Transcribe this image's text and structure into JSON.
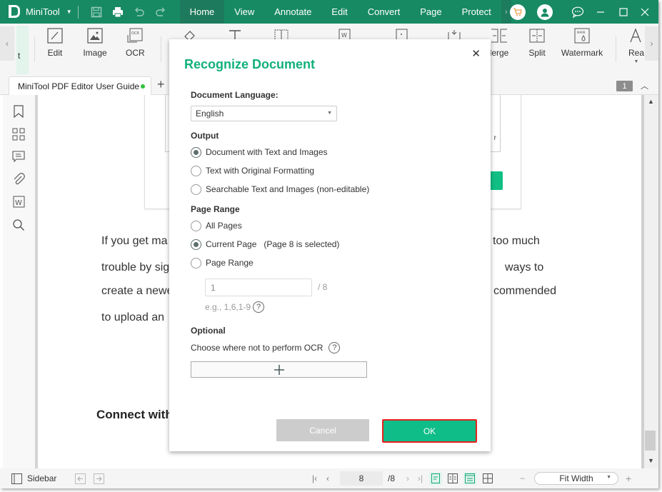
{
  "titlebar": {
    "app_name": "MiniTool",
    "menu": [
      "Home",
      "View",
      "Annotate",
      "Edit",
      "Convert",
      "Page",
      "Protect"
    ],
    "active_menu": "Home",
    "accent": "#178a64"
  },
  "ribbon": {
    "partial_left_label": "t",
    "tools": {
      "edit": "Edit",
      "image": "Image",
      "ocr": "OCR",
      "merge": "lerge",
      "split": "Split",
      "watermark": "Watermark",
      "read": "Rea"
    }
  },
  "tabs": {
    "document_tab": "MiniTool PDF Editor User Guide",
    "page_badge": "1"
  },
  "document": {
    "figure_partial_text": "r",
    "para_lines": [
      {
        "left": "If you get ma",
        "right": "too much"
      },
      {
        "left": "trouble by sig",
        "right": "ways to"
      },
      {
        "left": "create a newe",
        "right": "commended"
      },
      {
        "left": "to upload an",
        "right": ""
      }
    ],
    "heading_partial": "Connect with"
  },
  "dialog": {
    "title": "Recognize Document",
    "language_label": "Document Language:",
    "language_value": "English",
    "output_label": "Output",
    "output_options": [
      {
        "label": "Document with Text and Images",
        "selected": true
      },
      {
        "label": "Text with Original Formatting",
        "selected": false
      },
      {
        "label": "Searchable Text and Images (non-editable)",
        "selected": false
      }
    ],
    "page_range_label": "Page Range",
    "page_range_options": [
      {
        "label": "All Pages",
        "selected": false,
        "note": ""
      },
      {
        "label": "Current Page",
        "selected": true,
        "note": "(Page 8 is selected)"
      },
      {
        "label": "Page Range",
        "selected": false,
        "note": ""
      }
    ],
    "range_input_value": "1",
    "range_total": "/ 8",
    "range_hint": "e.g., 1,6,1-9",
    "help_glyph": "?",
    "optional_label": "Optional",
    "optional_desc": "Choose where not to perform OCR",
    "cancel_label": "Cancel",
    "ok_label": "OK",
    "ok_color": "#0fbd88",
    "highlight_color": "#e8201e"
  },
  "statusbar": {
    "sidebar_label": "Sidebar",
    "current_page": "8",
    "total_pages": "/8",
    "zoom_mode": "Fit Width",
    "zoom_minus": "−",
    "zoom_plus": "+"
  }
}
